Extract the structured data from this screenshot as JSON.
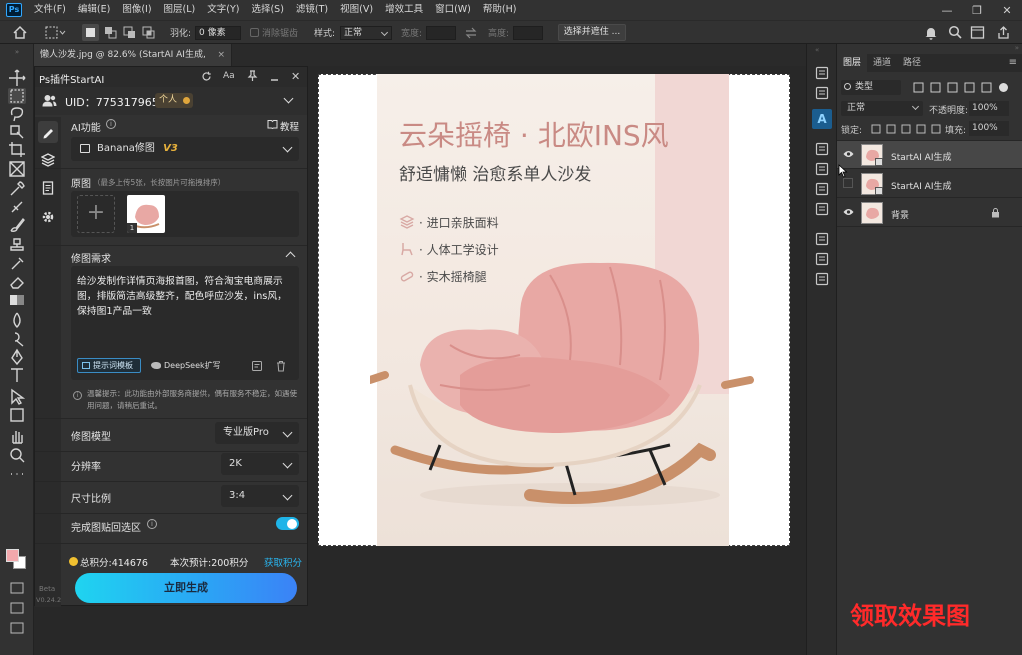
{
  "menubar": {
    "logo": "Ps",
    "items": [
      "文件(F)",
      "编辑(E)",
      "图像(I)",
      "图层(L)",
      "文字(Y)",
      "选择(S)",
      "滤镜(T)",
      "视图(V)",
      "增效工具",
      "窗口(W)",
      "帮助(H)"
    ],
    "window_controls": [
      "—",
      "❐",
      "✕"
    ]
  },
  "options_bar": {
    "feather_label": "羽化:",
    "feather_value": "0 像素",
    "antialias_label": "消除锯齿",
    "style_label": "样式:",
    "style_value": "正常",
    "width_label": "宽度:",
    "height_label": "高度:",
    "select_mask_button": "选择并遮住 ..."
  },
  "document": {
    "tab_title": "懒人沙发.jpg @ 82.6% (StartAI AI生成, RGB/8) *",
    "tab_close": "×"
  },
  "poster": {
    "title": "云朵摇椅 · 北欧INS风",
    "subtitle": "舒适慵懒 治愈系单人沙发",
    "features": [
      "· 进口亲肤面料",
      "· 人体工学设计",
      "· 实木摇椅腿"
    ],
    "colors": {
      "title": "#c98a84",
      "subtitle": "#4a4a4a",
      "chair": "#e8a8a4"
    }
  },
  "plugin": {
    "title": "Ps插件StartAI",
    "uid": "UID：775317965",
    "account_type": "个人",
    "ai_function_label": "AI功能",
    "tutorial_label": "教程",
    "model_select": "Banana修图",
    "model_version": "V3",
    "original_label": "原图",
    "original_hint": "（最多上传5张，长按图片可拖拽排序）",
    "thumb_index": "1",
    "requirement_label": "修图需求",
    "requirement_text": "给沙发制作详情页海报首图，符合淘宝电商展示图，排版简洁高级整齐，配色呼应沙发，ins风，保持图1产品一致",
    "prompt_template_btn": "提示词模板",
    "deepseek_btn": "DeepSeek扩写",
    "notice": "温馨提示：此功能由外部服务商提供，偶有服务不稳定，如遇使用问题，请稍后重试。",
    "model_label": "修图模型",
    "model_value": "专业版Pro",
    "resolution_label": "分辨率",
    "resolution_value": "2K",
    "ratio_label": "尺寸比例",
    "ratio_value": "3:4",
    "paste_back_label": "完成图贴回选区",
    "points_total": "总积分:414676",
    "points_estimate": "本次预计:200积分",
    "get_points": "获取积分",
    "generate_button": "立即生成",
    "beta_label": "Beta",
    "version": "V0.24.2"
  },
  "layers_panel": {
    "tabs": [
      "图层",
      "通道",
      "路径"
    ],
    "filter_label": "类型",
    "blend_mode": "正常",
    "opacity_label": "不透明度:",
    "opacity_value": "100%",
    "lock_label": "锁定:",
    "fill_label": "填充:",
    "fill_value": "100%",
    "layers": [
      {
        "name": "StartAI AI生成",
        "visible": true,
        "selected": true
      },
      {
        "name": "StartAI AI生成",
        "visible": false,
        "selected": false
      },
      {
        "name": "背景",
        "visible": true,
        "selected": false,
        "locked": true
      }
    ]
  },
  "overlay": {
    "watermark": "领取效果图",
    "color": "#ff2a2a"
  }
}
